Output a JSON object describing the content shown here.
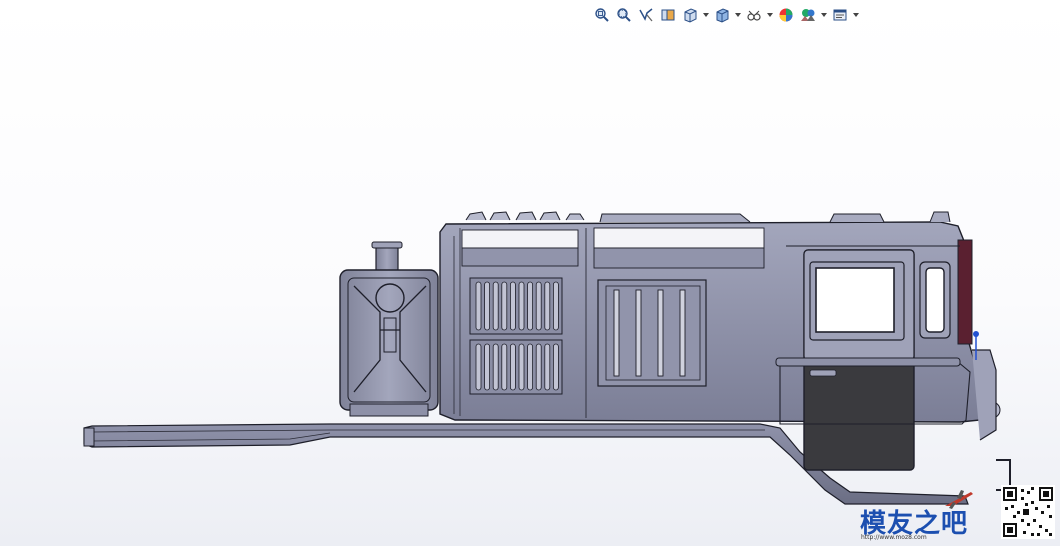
{
  "app": {
    "view_background": "#ffffff",
    "accent": "#1c4fb0"
  },
  "toolbar": {
    "buttons": [
      {
        "icon": "zoom-to-fit-icon",
        "has_dropdown": false
      },
      {
        "icon": "zoom-to-area-icon",
        "has_dropdown": false
      },
      {
        "icon": "previous-view-icon",
        "has_dropdown": false
      },
      {
        "icon": "section-view-icon",
        "has_dropdown": false
      },
      {
        "icon": "view-orientation-icon",
        "has_dropdown": true
      },
      {
        "icon": "display-style-icon",
        "has_dropdown": true
      },
      {
        "icon": "hide-show-items-icon",
        "has_dropdown": true
      },
      {
        "icon": "edit-appearance-icon",
        "has_dropdown": false
      },
      {
        "icon": "apply-scene-icon",
        "has_dropdown": true
      },
      {
        "icon": "view-settings-icon",
        "has_dropdown": true
      }
    ]
  },
  "model": {
    "description_icon": "locomotive-model",
    "body_color": "#8a8da6",
    "cab_window_color": "#3a3a3e"
  },
  "watermark": {
    "logo_text": "模友之吧",
    "url_text": "http://www.moz8.com"
  }
}
